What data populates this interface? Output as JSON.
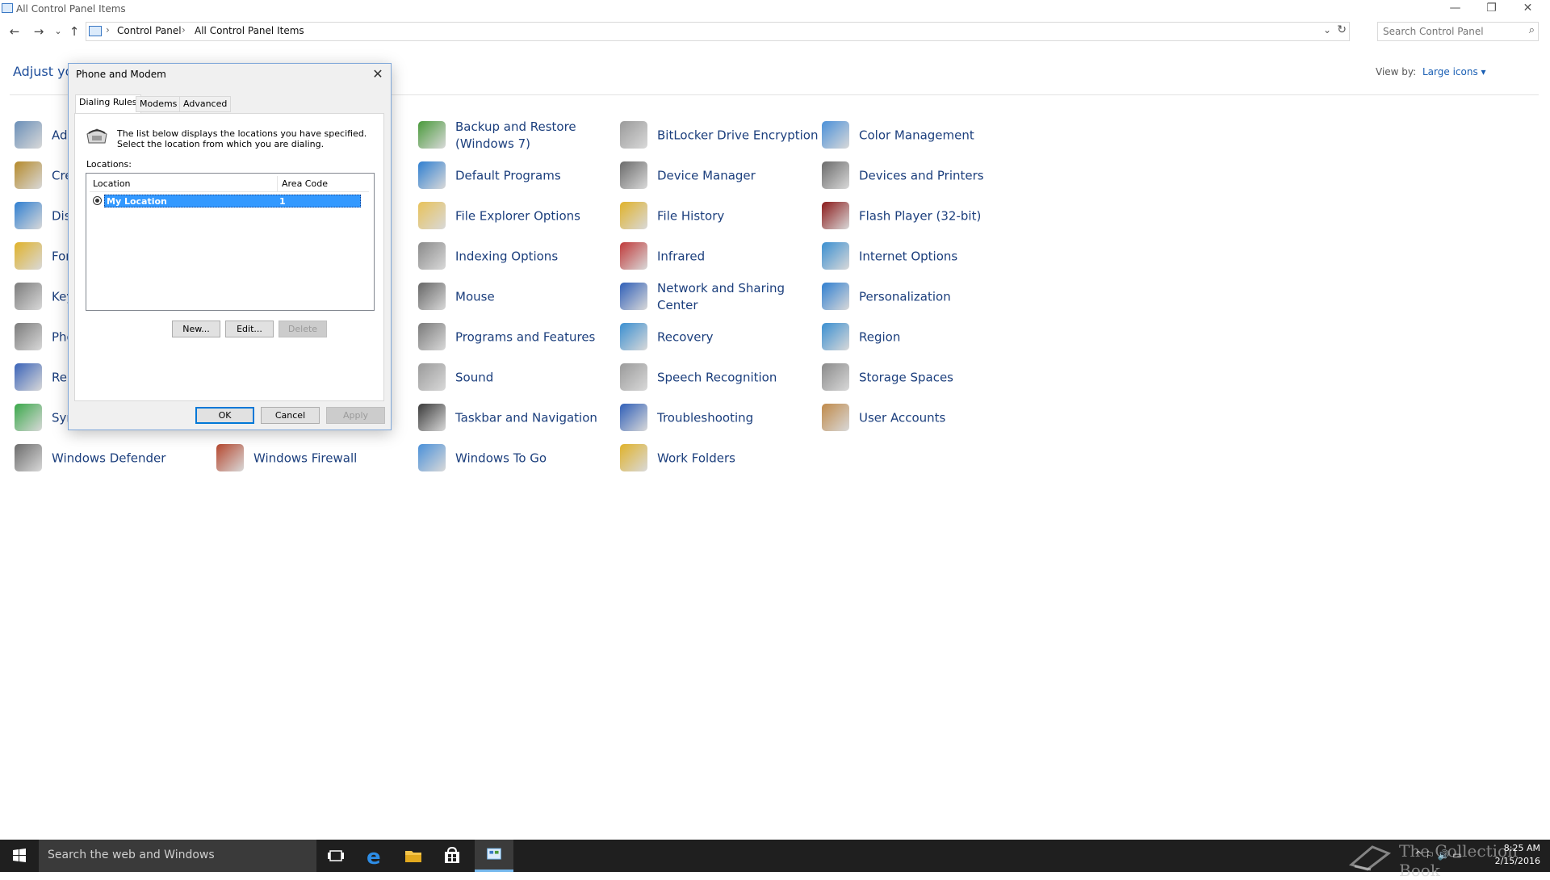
{
  "window": {
    "title": "All Control Panel Items",
    "controls": {
      "minimize": "—",
      "restore": "❐",
      "close": "✕"
    }
  },
  "nav": {
    "back": "←",
    "forward": "→",
    "recent": "⌄",
    "up": "↑"
  },
  "address": {
    "crumbs": [
      "Control Panel",
      "All Control Panel Items"
    ],
    "separator": "›",
    "dropdown": "⌄",
    "refresh": "↻"
  },
  "search": {
    "placeholder": "Search Control Panel",
    "icon": "⌕"
  },
  "header": {
    "adjust": "Adjust you",
    "view_by_label": "View by:",
    "view_by_value": "Large icons ▾"
  },
  "items": [
    {
      "label": "Adr",
      "color": "#6a8fb8"
    },
    {
      "label": "Cre",
      "color": "#b58a2b"
    },
    {
      "label": "Dis",
      "color": "#2f7fd1"
    },
    {
      "label": "For",
      "color": "#e0b22a"
    },
    {
      "label": "Key",
      "color": "#7b7b7b"
    },
    {
      "label": "Pho",
      "color": "#7b7b7b"
    },
    {
      "label": "Rer Cor",
      "color": "#3a63b8"
    },
    {
      "label": "Syr",
      "color": "#3aa84a"
    },
    {
      "label": "Windows Defender",
      "color": "#6b6b6b"
    },
    {
      "label": "Windows Firewall",
      "color": "#b5472e"
    },
    {
      "label": "Backup and Restore (Windows 7)",
      "color": "#4a9a3b"
    },
    {
      "label": "Default Programs",
      "color": "#2f7fd1"
    },
    {
      "label": "File Explorer Options",
      "color": "#e8c25a"
    },
    {
      "label": "Indexing Options",
      "color": "#8a8a8a"
    },
    {
      "label": "Mouse",
      "color": "#666666"
    },
    {
      "label": "Programs and Features",
      "color": "#7a7a7a"
    },
    {
      "label": "Sound",
      "color": "#9a9a9a"
    },
    {
      "label": "Taskbar and Navigation",
      "color": "#3a3a3a"
    },
    {
      "label": "Windows To Go",
      "color": "#4a90d9"
    },
    {
      "label": "BitLocker Drive Encryption",
      "color": "#9a9a9a"
    },
    {
      "label": "Device Manager",
      "color": "#6b6b6b"
    },
    {
      "label": "File History",
      "color": "#e0b22a"
    },
    {
      "label": "Infrared",
      "color": "#c03a3a"
    },
    {
      "label": "Network and Sharing Center",
      "color": "#2f5fb8"
    },
    {
      "label": "Recovery",
      "color": "#3a8fd1"
    },
    {
      "label": "Speech Recognition",
      "color": "#9a9a9a"
    },
    {
      "label": "Troubleshooting",
      "color": "#2f5fb8"
    },
    {
      "label": "Work Folders",
      "color": "#e0b22a"
    },
    {
      "label": "Color Management",
      "color": "#4a90d9"
    },
    {
      "label": "Devices and Printers",
      "color": "#6b6b6b"
    },
    {
      "label": "Flash Player (32-bit)",
      "color": "#8b1a1a"
    },
    {
      "label": "Internet Options",
      "color": "#3a8fd1"
    },
    {
      "label": "Personalization",
      "color": "#2f7fd1"
    },
    {
      "label": "Region",
      "color": "#3a8fd1"
    },
    {
      "label": "Storage Spaces",
      "color": "#8a8a8a"
    },
    {
      "label": "User Accounts",
      "color": "#c08a4a"
    }
  ],
  "dialog": {
    "title": "Phone and Modem",
    "close": "✕",
    "tabs": [
      "Dialing Rules",
      "Modems",
      "Advanced"
    ],
    "description": "The list below displays the locations you have specified. Select the location from which you are dialing.",
    "locations_label": "Locations:",
    "columns": [
      "Location",
      "Area Code"
    ],
    "rows": [
      {
        "location": "My Location",
        "area_code": "1"
      }
    ],
    "buttons": {
      "new": "New...",
      "edit": "Edit...",
      "delete": "Delete",
      "ok": "OK",
      "cancel": "Cancel",
      "apply": "Apply"
    }
  },
  "taskbar": {
    "search_placeholder": "Search the web and Windows",
    "watermark": "The Collection Book",
    "time": "8:25 AM",
    "date": "2/15/2016",
    "tray": "^ ⚐ 🔊 ▭"
  }
}
